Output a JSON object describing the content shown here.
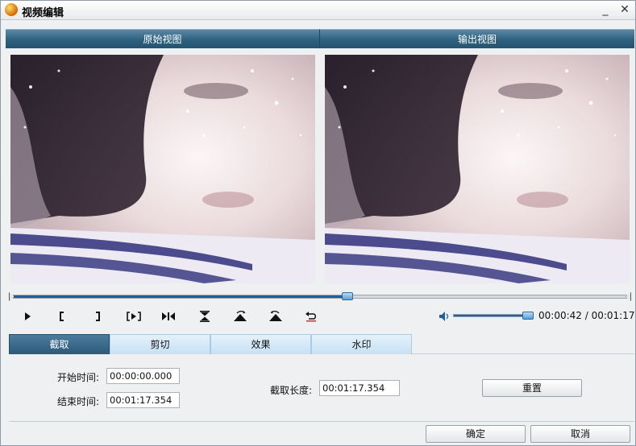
{
  "window": {
    "title": "视频编辑",
    "minimize_glyph": "_",
    "close_glyph": "✕"
  },
  "views": {
    "original_title": "原始视图",
    "output_title": "输出视图"
  },
  "playback": {
    "seek_progress": 0.545,
    "volume_level": 0.93,
    "time_readout": "00:00:42 / 00:01:17"
  },
  "controls": [
    {
      "name": "play-icon",
      "glyph": "▶"
    },
    {
      "name": "mark-in-icon",
      "glyph": "["
    },
    {
      "name": "mark-out-icon",
      "glyph": "]"
    },
    {
      "name": "play-selection-icon",
      "glyph": "[▶]"
    },
    {
      "name": "step-icon",
      "glyph": "▶|◀"
    },
    {
      "name": "flip-vertical-icon",
      "glyph": "⇅"
    },
    {
      "name": "rotate-right-icon",
      "glyph": "↷"
    },
    {
      "name": "rotate-left-icon",
      "glyph": "↶"
    },
    {
      "name": "undo-icon",
      "glyph": "↩"
    }
  ],
  "tabs": [
    "截取",
    "剪切",
    "效果",
    "水印"
  ],
  "active_tab": "截取",
  "trim": {
    "start_label": "开始时间:",
    "start_value": "00:00:00.000",
    "end_label": "结束时间:",
    "end_value": "00:01:17.354",
    "length_label": "截取长度:",
    "length_value": "00:01:17.354",
    "reset_label": "重置"
  },
  "footer": {
    "ok_label": "确定",
    "cancel_label": "取消"
  },
  "colors": {
    "header_blue": "#2e6180",
    "progress_blue": "#1b61a2",
    "tab_light": "#c6e1f4",
    "window_bg": "#eff0f2"
  }
}
